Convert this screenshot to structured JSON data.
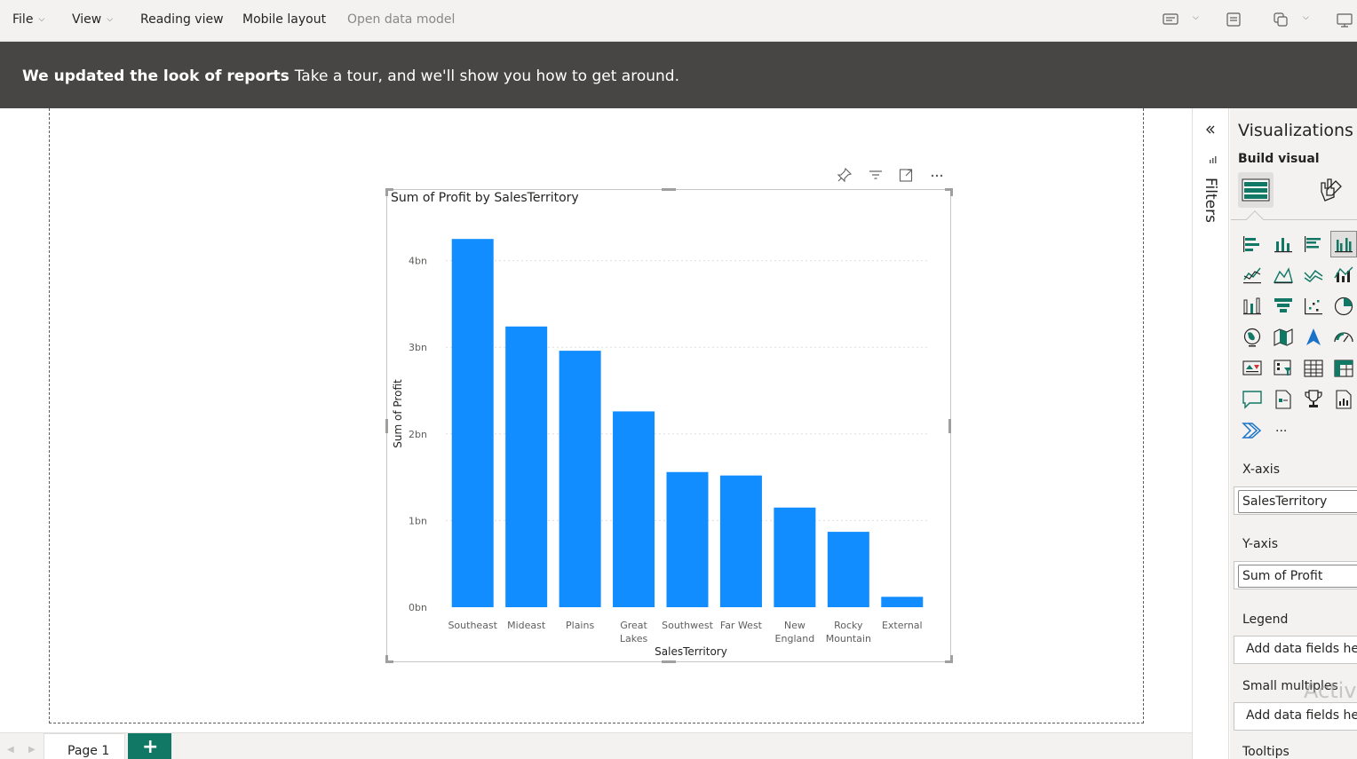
{
  "menu": {
    "file": "File",
    "view": "View",
    "reading_view": "Reading view",
    "mobile_layout": "Mobile layout",
    "open_data_model": "Open data model"
  },
  "banner": {
    "bold": "We updated the look of reports",
    "text": "Take a tour, and we'll show you how to get around."
  },
  "visual": {
    "title": "Sum of Profit by SalesTerritory"
  },
  "chart_data": {
    "type": "bar",
    "title": "Sum of Profit by SalesTerritory",
    "xlabel": "SalesTerritory",
    "ylabel": "Sum of Profit",
    "categories": [
      "Southeast",
      "Mideast",
      "Plains",
      "Great Lakes",
      "Southwest",
      "Far West",
      "New England",
      "Rocky Mountain",
      "External"
    ],
    "category_lines": [
      [
        "Southeast"
      ],
      [
        "Mideast"
      ],
      [
        "Plains"
      ],
      [
        "Great",
        "Lakes"
      ],
      [
        "Southwest"
      ],
      [
        "Far West"
      ],
      [
        "New",
        "England"
      ],
      [
        "Rocky",
        "Mountain"
      ],
      [
        "External"
      ]
    ],
    "values": [
      4.25,
      3.24,
      2.96,
      2.26,
      1.56,
      1.52,
      1.15,
      0.87,
      0.12
    ],
    "value_unit": "bn",
    "ylim": [
      0,
      4.4
    ],
    "yticks": [
      0,
      1,
      2,
      3,
      4
    ],
    "ytick_labels": [
      "0bn",
      "1bn",
      "2bn",
      "3bn",
      "4bn"
    ],
    "grid": true,
    "bar_color": "#118DFF"
  },
  "filters": {
    "label": "Filters"
  },
  "viz_pane": {
    "title": "Visualizations",
    "subtitle": "Build visual",
    "more": "...",
    "wells": {
      "x_axis_label": "X-axis",
      "x_axis_field": "SalesTerritory",
      "y_axis_label": "Y-axis",
      "y_axis_field": "Sum of Profit",
      "legend_label": "Legend",
      "legend_placeholder": "Add data fields here",
      "small_multiples_label": "Small multiples",
      "small_multiples_placeholder": "Add data fields here",
      "tooltips_label": "Tooltips"
    }
  },
  "watermark": "Activa",
  "pages": {
    "page1": "Page 1",
    "add": "+"
  },
  "colors": {
    "accent_green": "#117865",
    "bar_blue": "#118DFF",
    "banner_bg": "#484644"
  }
}
